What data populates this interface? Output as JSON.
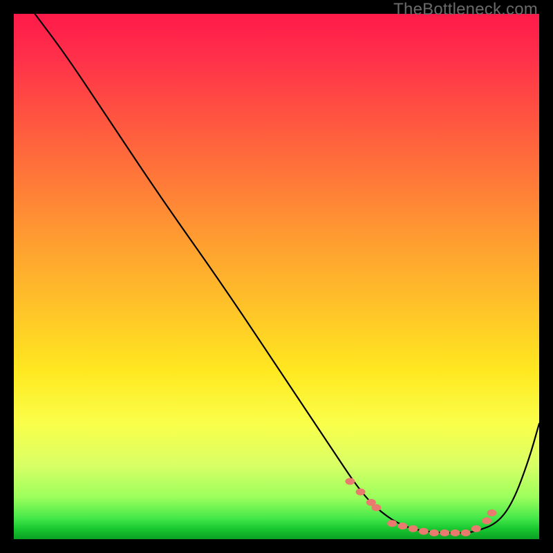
{
  "watermark": "TheBottleneck.com",
  "chart_data": {
    "type": "line",
    "title": "",
    "xlabel": "",
    "ylabel": "",
    "xlim": [
      0,
      100
    ],
    "ylim": [
      0,
      100
    ],
    "series": [
      {
        "name": "bottleneck-curve",
        "x": [
          4,
          10,
          18,
          28,
          40,
          52,
          60,
          66,
          70,
          74,
          78,
          82,
          86,
          88,
          92,
          95,
          98,
          100
        ],
        "y": [
          100,
          92,
          80,
          65,
          48,
          30,
          18,
          9,
          5,
          2.5,
          1.5,
          1.2,
          1.2,
          1.5,
          3,
          7,
          15,
          22
        ]
      }
    ],
    "markers": {
      "name": "highlight-dots",
      "color": "#e97a6e",
      "points": [
        {
          "x": 64,
          "y": 11
        },
        {
          "x": 66,
          "y": 9
        },
        {
          "x": 68,
          "y": 7
        },
        {
          "x": 69,
          "y": 6
        },
        {
          "x": 72,
          "y": 3
        },
        {
          "x": 74,
          "y": 2.5
        },
        {
          "x": 76,
          "y": 2
        },
        {
          "x": 78,
          "y": 1.5
        },
        {
          "x": 80,
          "y": 1.2
        },
        {
          "x": 82,
          "y": 1.2
        },
        {
          "x": 84,
          "y": 1.2
        },
        {
          "x": 86,
          "y": 1.2
        },
        {
          "x": 88,
          "y": 2
        },
        {
          "x": 90,
          "y": 3.5
        },
        {
          "x": 91,
          "y": 5
        }
      ]
    },
    "gradient_stops": [
      {
        "pos": 0,
        "color": "#ff1a4a"
      },
      {
        "pos": 20,
        "color": "#ff5540"
      },
      {
        "pos": 44,
        "color": "#ffa030"
      },
      {
        "pos": 68,
        "color": "#ffe820"
      },
      {
        "pos": 86,
        "color": "#d8ff66"
      },
      {
        "pos": 96,
        "color": "#45e84a"
      },
      {
        "pos": 100,
        "color": "#0aa024"
      }
    ]
  }
}
